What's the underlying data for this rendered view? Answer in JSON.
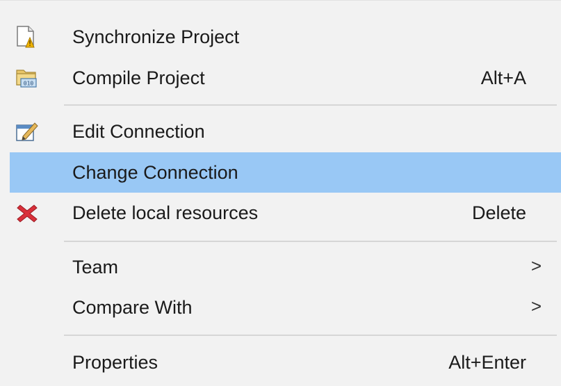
{
  "menu": {
    "items": [
      {
        "label": "Synchronize Project",
        "shortcut": "",
        "icon": "synchronize-project-icon"
      },
      {
        "label": "Compile Project",
        "shortcut": "Alt+A",
        "icon": "compile-project-icon"
      },
      {
        "label": "Edit Connection",
        "shortcut": "",
        "icon": "edit-connection-icon"
      },
      {
        "label": "Change Connection",
        "shortcut": "",
        "icon": "",
        "selected": true
      },
      {
        "label": "Delete local resources",
        "shortcut": "Delete",
        "icon": "delete-icon"
      },
      {
        "label": "Team",
        "shortcut": "",
        "submenu_arrow": ">"
      },
      {
        "label": "Compare With",
        "shortcut": "",
        "submenu_arrow": ">"
      },
      {
        "label": "Properties",
        "shortcut": "Alt+Enter",
        "icon": ""
      }
    ]
  },
  "colors": {
    "menu_background": "#f2f2f2",
    "selection_highlight": "#99c8f5",
    "separator": "#d6d6d6",
    "delete_icon": "#d9303a"
  }
}
